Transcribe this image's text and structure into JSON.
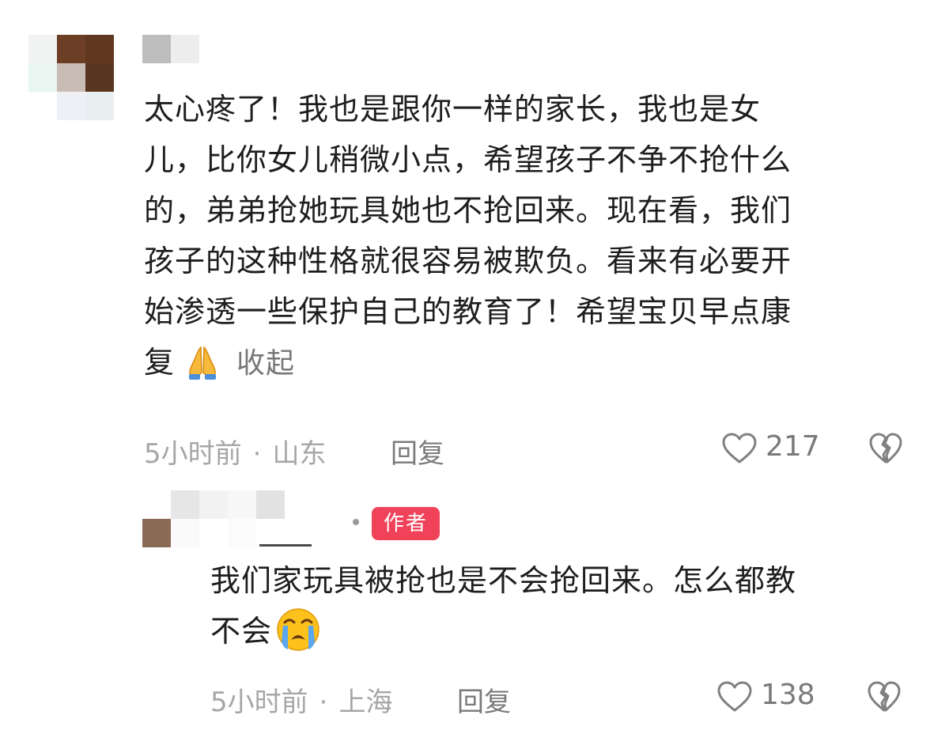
{
  "comments": [
    {
      "text_lines": [
        "太心疼了！我也是跟你一样的家长，我也是女",
        "儿，比你女儿稍微小点，希望孩子不争不抢什么",
        "的，弟弟抢她玩具她也不抢回来。现在看，我们",
        "孩子的这种性格就很容易被欺负。看来有必要开",
        "始渗透一些保护自己的教育了！希望宝贝早点康",
        "复"
      ],
      "emoji": "folded-hands",
      "collapse_label": "收起",
      "time": "5小时前",
      "location": "山东",
      "reply_label": "回复",
      "likes": "217"
    },
    {
      "author_badge": "作者",
      "text_lines": [
        "我们家玩具被抢也是不会抢回来。怎么都教",
        "不会"
      ],
      "emoji": "loudly-crying-face",
      "time": "5小时前",
      "location": "上海",
      "reply_label": "回复",
      "likes": "138"
    }
  ],
  "separator": "·",
  "colors": {
    "meta_gray": "#a6a6a6",
    "action_gray": "#7a7a7a",
    "badge_red": "#f0435a",
    "text": "#1e1e1e"
  }
}
